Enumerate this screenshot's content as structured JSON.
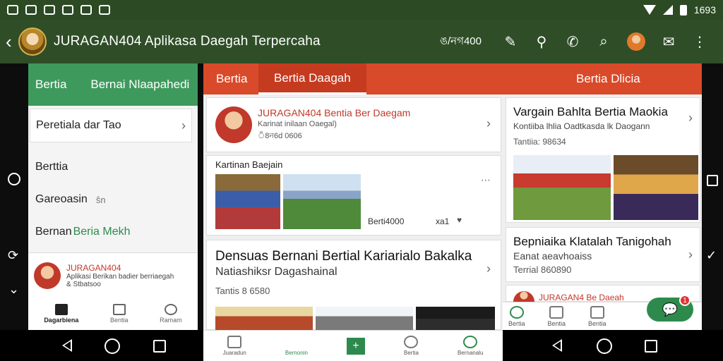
{
  "status": {
    "time": "1693"
  },
  "appbar": {
    "title": "JURAGAN404 Aplikasa Daegah Terpercaha",
    "code": "ঙ/নগ400"
  },
  "left_panel": {
    "tab1": "Bertia",
    "tab2": "Bernai Nlaapahedi",
    "card_label": "Peretiala dar Tao",
    "items": [
      {
        "label": "Berttia"
      },
      {
        "label": "Gareoasin",
        "suffix": "ŝn"
      },
      {
        "prefix": "Bernan",
        "label": "Beria Mekh"
      }
    ],
    "profile": {
      "name": "JURAGAN404",
      "line1": "Aplikasi Berikan badier berriaegah",
      "line2": "& Stbatsoo"
    },
    "bottom_nav": [
      "Dagarbiena",
      "Bentia",
      "Ramam"
    ]
  },
  "tabs": {
    "tab1": "Bertia",
    "tab2": "Bertia Daagah",
    "tab3": "Bertia Dlicia"
  },
  "center": {
    "card1": {
      "title": "JURAGAN404 Bentia Ber Daegam",
      "subtitle": "Karinat inilaan Oaegal)",
      "meta": "ঁ8ন6d 0606"
    },
    "card2": {
      "title": "Kartinan Baejain",
      "stat1": "Berti4000",
      "stat2": "xa1"
    },
    "card3": {
      "title": "Densuas Bernani Bertial Kariarialo Bakalka",
      "subtitle": "Natiashiksr Dagashainal",
      "meta": "Tantis 8 6580"
    },
    "bottom_nav": [
      "Juaradun",
      "Bernonin",
      "",
      "Bertia",
      "Bernanalu"
    ]
  },
  "right": {
    "card1": {
      "title": "Vargain Bahlta Bertia Maokia",
      "subtitle": "Kontiiba lhlia Oadtkasda lk Daogann",
      "meta": "Tantiia: 98634"
    },
    "card2": {
      "title": "Bepniaika Klatalah Tanigohah",
      "subtitle": "Eanat aeavhoaiss",
      "meta": "Terrial 860890"
    },
    "card3": {
      "title": "JURAGAN4 Be Daeah"
    },
    "bottom_nav": [
      "Bertia",
      "Bentia",
      "Bentia"
    ]
  },
  "colors": {
    "appbar": "#2f4e27",
    "accent_green": "#3e9a5c",
    "accent_red": "#d84a2a"
  }
}
